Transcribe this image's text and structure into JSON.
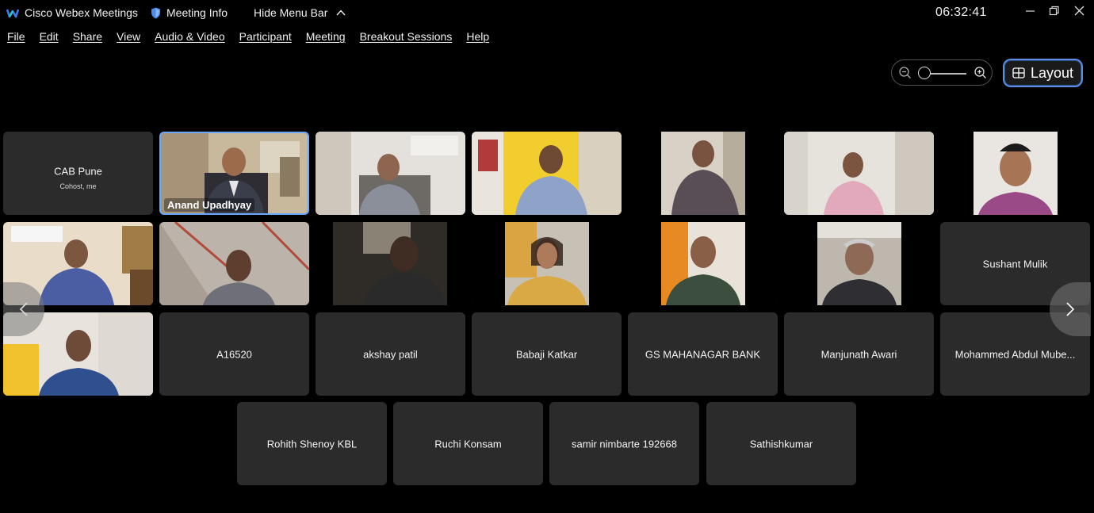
{
  "titlebar": {
    "app_name": "Cisco Webex Meetings",
    "meeting_info": "Meeting Info",
    "hide_menu_bar": "Hide Menu Bar",
    "clock": "06:32:41"
  },
  "menubar": {
    "items": [
      "File",
      "Edit",
      "Share",
      "View",
      "Audio & Video",
      "Participant",
      "Meeting",
      "Breakout Sessions",
      "Help"
    ]
  },
  "toolbar": {
    "layout_label": "Layout",
    "zoom_level": 0.0
  },
  "participants": {
    "cab_pune": {
      "name": "CAB Pune",
      "sub": "Cohost, me"
    },
    "anand": {
      "label": "Anand Upadhyay"
    },
    "sushant": {
      "name": "Sushant Mulik"
    },
    "a16520": {
      "name": "A16520"
    },
    "akshay": {
      "name": "akshay patil"
    },
    "babaji": {
      "name": "Babaji Katkar"
    },
    "gs_bank": {
      "name": "GS MAHANAGAR BANK"
    },
    "manjunath": {
      "name": "Manjunath Awari"
    },
    "mohammed": {
      "name": "Mohammed Abdul Mube..."
    },
    "rohith": {
      "name": "Rohith Shenoy KBL"
    },
    "ruchi": {
      "name": "Ruchi Konsam"
    },
    "samir": {
      "name": "samir nimbarte 192668"
    },
    "sathish": {
      "name": "Sathishkumar"
    }
  },
  "colors": {
    "accent": "#6aa7ff",
    "tile_bg": "#2b2b2b",
    "background": "#000000"
  }
}
